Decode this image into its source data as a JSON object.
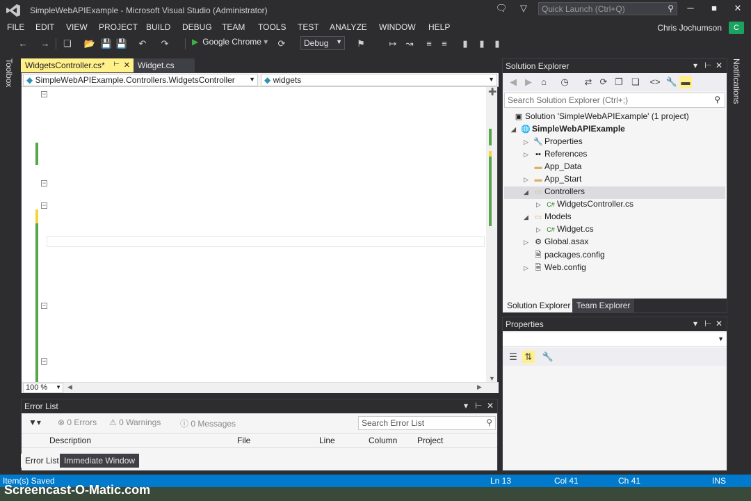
{
  "window": {
    "title": "SimpleWebAPIExample - Microsoft Visual Studio (Administrator)",
    "quick_launch_placeholder": "Quick Launch (Ctrl+Q)"
  },
  "menu": [
    "FILE",
    "EDIT",
    "VIEW",
    "PROJECT",
    "BUILD",
    "DEBUG",
    "TEAM",
    "TOOLS",
    "TEST",
    "ANALYZE",
    "WINDOW",
    "HELP"
  ],
  "user": {
    "name": "Chris Jochumson",
    "avatar_initial": "C"
  },
  "toolbar": {
    "run_label": "Google Chrome",
    "config": "Debug"
  },
  "side_strips": {
    "toolbox": "Toolbox",
    "notifications": "Notifications"
  },
  "editor": {
    "tabs": [
      {
        "label": "WidgetsController.cs*",
        "active": true
      },
      {
        "label": "Widget.cs",
        "active": false
      }
    ],
    "nav_class": "SimpleWebAPIExample.Controllers.WidgetsController",
    "nav_member": "widgets",
    "zoom": "100 %"
  },
  "error_list": {
    "title": "Error List",
    "errors": "0 Errors",
    "warnings": "0 Warnings",
    "messages": "0 Messages",
    "search_placeholder": "Search Error List",
    "columns": [
      "Description",
      "File",
      "Line",
      "Column",
      "Project"
    ],
    "bottom_tabs": [
      "Error List",
      "Immediate Window"
    ]
  },
  "solution_explorer": {
    "title": "Solution Explorer",
    "search_placeholder": "Search Solution Explorer (Ctrl+;)",
    "tree": [
      {
        "label": "Solution 'SimpleWebAPIExample' (1 project)",
        "icon": "solution-icon"
      },
      {
        "label": "SimpleWebAPIExample",
        "icon": "web-project-icon"
      },
      {
        "label": "Properties",
        "icon": "wrench-icon"
      },
      {
        "label": "References",
        "icon": "references-icon"
      },
      {
        "label": "App_Data",
        "icon": "folder-icon"
      },
      {
        "label": "App_Start",
        "icon": "folder-icon"
      },
      {
        "label": "Controllers",
        "icon": "folder-icon"
      },
      {
        "label": "WidgetsController.cs",
        "icon": "csharp-file-icon"
      },
      {
        "label": "Models",
        "icon": "folder-icon"
      },
      {
        "label": "Widget.cs",
        "icon": "csharp-file-icon"
      },
      {
        "label": "Global.asax",
        "icon": "global-file-icon"
      },
      {
        "label": "packages.config",
        "icon": "config-file-icon"
      },
      {
        "label": "Web.config",
        "icon": "config-file-icon"
      }
    ],
    "bottom_tabs": [
      "Solution Explorer",
      "Team Explorer"
    ]
  },
  "properties": {
    "title": "Properties"
  },
  "status": {
    "message": "Item(s) Saved",
    "ln": "Ln 13",
    "col": "Col 41",
    "ch": "Ch 41",
    "mode": "INS"
  },
  "watermark": "Screencast-O-Matic.com",
  "colors": {
    "accent": "#007acc",
    "chrome": "#2d2d30",
    "active_tab": "#fff08a"
  }
}
